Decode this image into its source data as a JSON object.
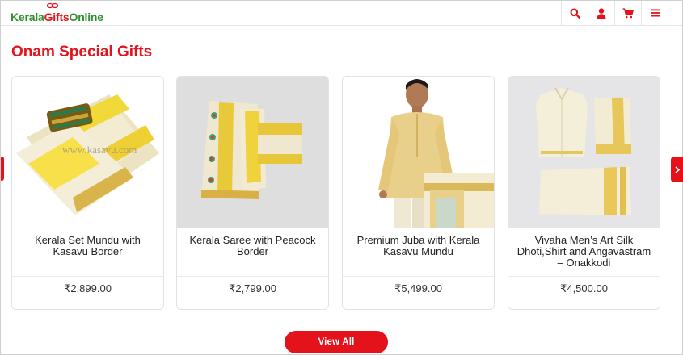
{
  "header": {
    "logo": {
      "part1": "Kerala",
      "part2": "Gifts",
      "part3": "Online"
    },
    "icons": [
      "search-icon",
      "user-icon",
      "cart-icon",
      "menu-icon"
    ]
  },
  "section": {
    "title": "Onam Special Gifts"
  },
  "products": [
    {
      "name": "Kerala Set Mundu with Kasavu Border",
      "price": "₹2,899.00",
      "image_watermark": "www.kasavu.com"
    },
    {
      "name": "Kerala Saree with Peacock Border",
      "price": "₹2,799.00"
    },
    {
      "name": "Premium Juba with Kerala Kasavu Mundu",
      "price": "₹5,499.00"
    },
    {
      "name": "Vivaha Men’s Art Silk Dhoti,Shirt and Angavastram – Onakkodi",
      "price": "₹4,500.00"
    }
  ],
  "view_all_label": "View All",
  "colors": {
    "brand_red": "#e3121b",
    "brand_green": "#2f8f2f",
    "kasavu_gold": "#e9c23a",
    "cream": "#f1ead1"
  }
}
